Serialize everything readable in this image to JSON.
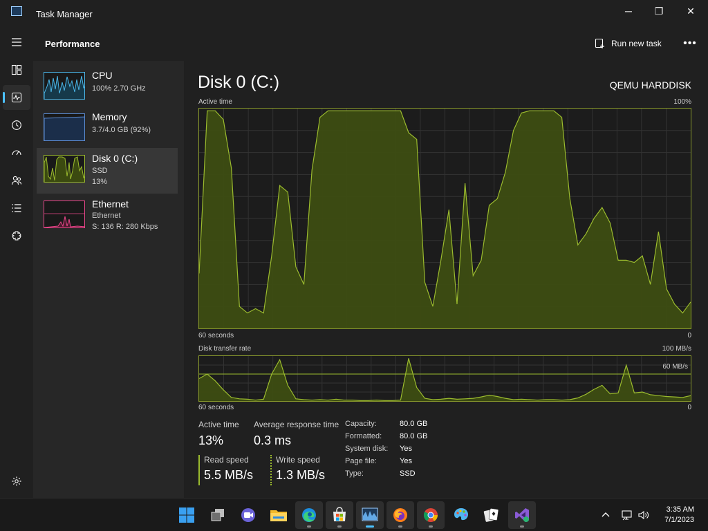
{
  "window": {
    "title": "Task Manager",
    "minimize_glyph": "─",
    "maximize_glyph": "❐",
    "close_glyph": "✕"
  },
  "nav": {
    "items": [
      {
        "name": "hamburger-menu-icon"
      },
      {
        "name": "processes-icon"
      },
      {
        "name": "performance-icon",
        "active": true
      },
      {
        "name": "app-history-icon"
      },
      {
        "name": "startup-apps-icon"
      },
      {
        "name": "users-icon"
      },
      {
        "name": "details-icon"
      },
      {
        "name": "services-icon"
      }
    ],
    "settings": "settings-gear-icon"
  },
  "header": {
    "title": "Performance",
    "run_new_task": "Run new task",
    "more": "•••"
  },
  "resources": [
    {
      "name": "CPU",
      "line1": "100% 2.70 GHz",
      "line2": "",
      "color": "#4bb6e8"
    },
    {
      "name": "Memory",
      "line1": "3.7/4.0 GB (92%)",
      "line2": "",
      "color": "#5b8bd1"
    },
    {
      "name": "Disk 0 (C:)",
      "line1": "SSD",
      "line2": "13%",
      "color": "#9bbb2e"
    },
    {
      "name": "Ethernet",
      "line1": "Ethernet",
      "line2": "S: 136 R: 280 Kbps",
      "color": "#e8468a"
    }
  ],
  "detail": {
    "title": "Disk 0 (C:)",
    "model": "QEMU HARDDISK",
    "active_graph": {
      "label": "Active time",
      "max_label": "100%",
      "x_left": "60 seconds",
      "x_right": "0",
      "series": [
        25,
        99,
        99,
        95,
        73,
        10,
        7,
        9,
        7,
        33,
        65,
        62,
        28,
        20,
        72,
        96,
        99,
        99,
        99,
        99,
        99,
        99,
        99,
        99,
        99,
        99,
        89,
        86,
        21,
        10,
        31,
        54,
        11,
        66,
        24,
        31,
        56,
        59,
        71,
        90,
        98,
        99,
        99,
        99,
        99,
        96,
        59,
        38,
        43,
        50,
        55,
        48,
        31,
        31,
        30,
        33,
        20,
        44,
        18,
        11,
        7,
        12
      ]
    },
    "transfer_graph": {
      "label": "Disk transfer rate",
      "max_label": "100 MB/s",
      "ref_label": "60 MB/s",
      "ref_value": 60,
      "x_left": "60 seconds",
      "x_right": "0",
      "series": [
        50,
        60,
        45,
        25,
        8,
        5,
        4,
        2,
        4,
        60,
        92,
        35,
        5,
        3,
        2,
        3,
        2,
        4,
        2,
        2,
        1,
        1,
        2,
        1,
        1,
        2,
        95,
        30,
        6,
        3,
        4,
        6,
        4,
        5,
        6,
        9,
        13,
        10,
        6,
        3,
        4,
        3,
        2,
        3,
        3,
        2,
        3,
        7,
        15,
        26,
        35,
        16,
        18,
        80,
        18,
        20,
        14,
        12,
        10,
        9,
        8,
        12
      ]
    },
    "stats": {
      "active_time_label": "Active time",
      "active_time": "13%",
      "avg_response_label": "Average response time",
      "avg_response": "0.3 ms",
      "read_label": "Read speed",
      "read": "5.5 MB/s",
      "write_label": "Write speed",
      "write": "1.3 MB/s"
    },
    "properties": [
      {
        "key": "Capacity:",
        "value": "80.0 GB"
      },
      {
        "key": "Formatted:",
        "value": "80.0 GB"
      },
      {
        "key": "System disk:",
        "value": "Yes"
      },
      {
        "key": "Page file:",
        "value": "Yes"
      },
      {
        "key": "Type:",
        "value": "SSD"
      }
    ]
  },
  "taskbar": {
    "apps": [
      {
        "name": "start-windows-icon",
        "running": false
      },
      {
        "name": "task-view-icon",
        "running": false
      },
      {
        "name": "chat-icon",
        "running": false
      },
      {
        "name": "file-explorer-icon",
        "running": false
      },
      {
        "name": "edge-browser-icon",
        "running": true
      },
      {
        "name": "microsoft-store-icon",
        "running": true
      },
      {
        "name": "task-manager-icon",
        "running": true,
        "active": true
      },
      {
        "name": "firefox-icon",
        "running": true
      },
      {
        "name": "chrome-icon",
        "running": true
      },
      {
        "name": "paint-icon",
        "running": false
      },
      {
        "name": "solitaire-icon",
        "running": false
      },
      {
        "name": "visual-studio-icon",
        "running": true
      }
    ],
    "tray": [
      "chevron-up-icon",
      "network-icon",
      "volume-icon"
    ],
    "time": "3:35 AM",
    "date": "7/1/2023"
  }
}
